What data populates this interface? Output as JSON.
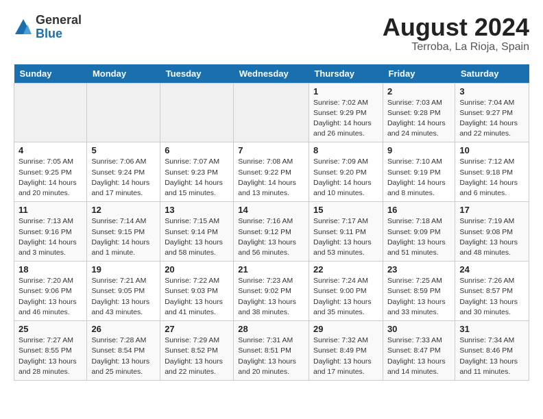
{
  "header": {
    "logo_general": "General",
    "logo_blue": "Blue",
    "month_year": "August 2024",
    "location": "Terroba, La Rioja, Spain"
  },
  "weekdays": [
    "Sunday",
    "Monday",
    "Tuesday",
    "Wednesday",
    "Thursday",
    "Friday",
    "Saturday"
  ],
  "weeks": [
    [
      {
        "day": "",
        "info": ""
      },
      {
        "day": "",
        "info": ""
      },
      {
        "day": "",
        "info": ""
      },
      {
        "day": "",
        "info": ""
      },
      {
        "day": "1",
        "info": "Sunrise: 7:02 AM\nSunset: 9:29 PM\nDaylight: 14 hours and 26 minutes."
      },
      {
        "day": "2",
        "info": "Sunrise: 7:03 AM\nSunset: 9:28 PM\nDaylight: 14 hours and 24 minutes."
      },
      {
        "day": "3",
        "info": "Sunrise: 7:04 AM\nSunset: 9:27 PM\nDaylight: 14 hours and 22 minutes."
      }
    ],
    [
      {
        "day": "4",
        "info": "Sunrise: 7:05 AM\nSunset: 9:25 PM\nDaylight: 14 hours and 20 minutes."
      },
      {
        "day": "5",
        "info": "Sunrise: 7:06 AM\nSunset: 9:24 PM\nDaylight: 14 hours and 17 minutes."
      },
      {
        "day": "6",
        "info": "Sunrise: 7:07 AM\nSunset: 9:23 PM\nDaylight: 14 hours and 15 minutes."
      },
      {
        "day": "7",
        "info": "Sunrise: 7:08 AM\nSunset: 9:22 PM\nDaylight: 14 hours and 13 minutes."
      },
      {
        "day": "8",
        "info": "Sunrise: 7:09 AM\nSunset: 9:20 PM\nDaylight: 14 hours and 10 minutes."
      },
      {
        "day": "9",
        "info": "Sunrise: 7:10 AM\nSunset: 9:19 PM\nDaylight: 14 hours and 8 minutes."
      },
      {
        "day": "10",
        "info": "Sunrise: 7:12 AM\nSunset: 9:18 PM\nDaylight: 14 hours and 6 minutes."
      }
    ],
    [
      {
        "day": "11",
        "info": "Sunrise: 7:13 AM\nSunset: 9:16 PM\nDaylight: 14 hours and 3 minutes."
      },
      {
        "day": "12",
        "info": "Sunrise: 7:14 AM\nSunset: 9:15 PM\nDaylight: 14 hours and 1 minute."
      },
      {
        "day": "13",
        "info": "Sunrise: 7:15 AM\nSunset: 9:14 PM\nDaylight: 13 hours and 58 minutes."
      },
      {
        "day": "14",
        "info": "Sunrise: 7:16 AM\nSunset: 9:12 PM\nDaylight: 13 hours and 56 minutes."
      },
      {
        "day": "15",
        "info": "Sunrise: 7:17 AM\nSunset: 9:11 PM\nDaylight: 13 hours and 53 minutes."
      },
      {
        "day": "16",
        "info": "Sunrise: 7:18 AM\nSunset: 9:09 PM\nDaylight: 13 hours and 51 minutes."
      },
      {
        "day": "17",
        "info": "Sunrise: 7:19 AM\nSunset: 9:08 PM\nDaylight: 13 hours and 48 minutes."
      }
    ],
    [
      {
        "day": "18",
        "info": "Sunrise: 7:20 AM\nSunset: 9:06 PM\nDaylight: 13 hours and 46 minutes."
      },
      {
        "day": "19",
        "info": "Sunrise: 7:21 AM\nSunset: 9:05 PM\nDaylight: 13 hours and 43 minutes."
      },
      {
        "day": "20",
        "info": "Sunrise: 7:22 AM\nSunset: 9:03 PM\nDaylight: 13 hours and 41 minutes."
      },
      {
        "day": "21",
        "info": "Sunrise: 7:23 AM\nSunset: 9:02 PM\nDaylight: 13 hours and 38 minutes."
      },
      {
        "day": "22",
        "info": "Sunrise: 7:24 AM\nSunset: 9:00 PM\nDaylight: 13 hours and 35 minutes."
      },
      {
        "day": "23",
        "info": "Sunrise: 7:25 AM\nSunset: 8:59 PM\nDaylight: 13 hours and 33 minutes."
      },
      {
        "day": "24",
        "info": "Sunrise: 7:26 AM\nSunset: 8:57 PM\nDaylight: 13 hours and 30 minutes."
      }
    ],
    [
      {
        "day": "25",
        "info": "Sunrise: 7:27 AM\nSunset: 8:55 PM\nDaylight: 13 hours and 28 minutes."
      },
      {
        "day": "26",
        "info": "Sunrise: 7:28 AM\nSunset: 8:54 PM\nDaylight: 13 hours and 25 minutes."
      },
      {
        "day": "27",
        "info": "Sunrise: 7:29 AM\nSunset: 8:52 PM\nDaylight: 13 hours and 22 minutes."
      },
      {
        "day": "28",
        "info": "Sunrise: 7:31 AM\nSunset: 8:51 PM\nDaylight: 13 hours and 20 minutes."
      },
      {
        "day": "29",
        "info": "Sunrise: 7:32 AM\nSunset: 8:49 PM\nDaylight: 13 hours and 17 minutes."
      },
      {
        "day": "30",
        "info": "Sunrise: 7:33 AM\nSunset: 8:47 PM\nDaylight: 13 hours and 14 minutes."
      },
      {
        "day": "31",
        "info": "Sunrise: 7:34 AM\nSunset: 8:46 PM\nDaylight: 13 hours and 11 minutes."
      }
    ]
  ]
}
